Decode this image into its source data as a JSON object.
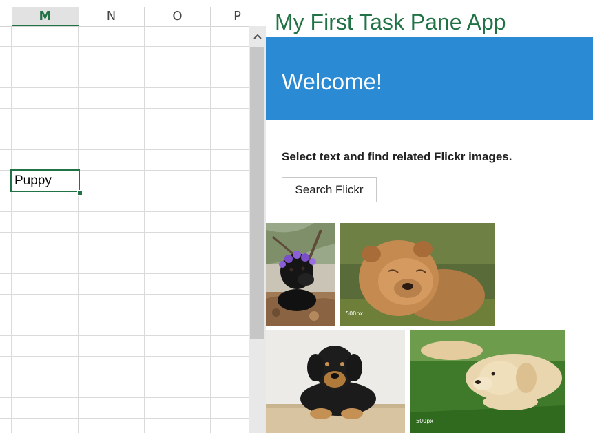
{
  "spreadsheet": {
    "columns": [
      "M",
      "N",
      "O",
      "P"
    ],
    "active_column": "M",
    "selected_cell_value": "Puppy"
  },
  "task_pane": {
    "title": "My First Task Pane App",
    "banner": "Welcome!",
    "instruction": "Select text and find related Flickr images.",
    "search_button": "Search Flickr",
    "accent_color": "#2a8ad4",
    "title_color": "#217346"
  },
  "results": {
    "images": [
      {
        "subject": "black puppy with purple flower wreath"
      },
      {
        "subject": "chow chow dog",
        "watermark": "500px"
      },
      {
        "subject": "black and tan puppy on wooden floor"
      },
      {
        "subject": "yellow labrador puppy lying in grass",
        "watermark": "500px"
      }
    ]
  }
}
